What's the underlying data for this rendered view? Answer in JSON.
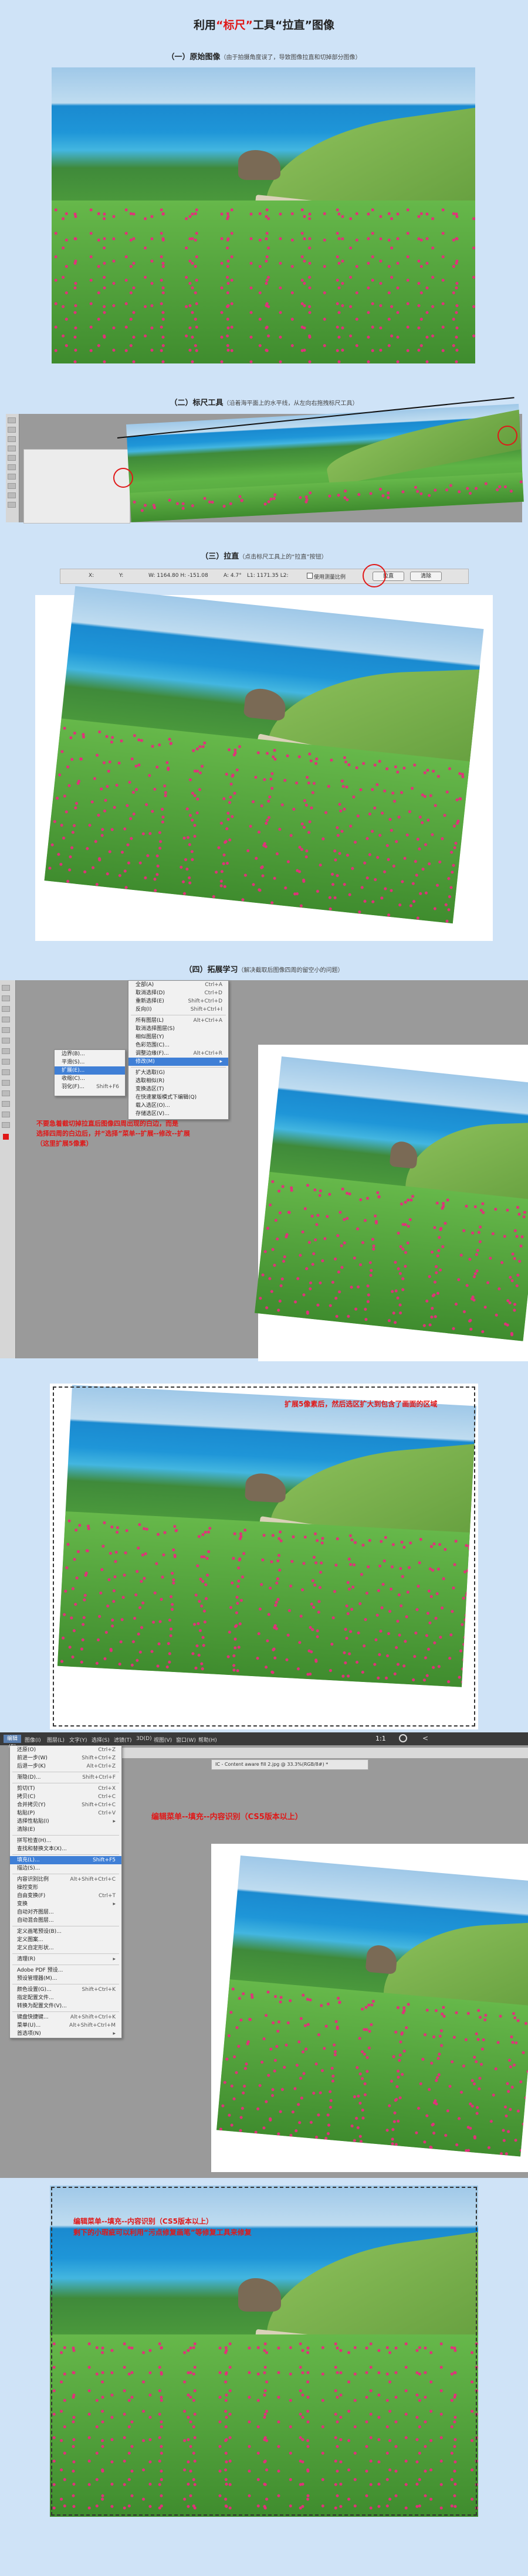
{
  "title": {
    "pre": "利用",
    "highlight": "“标尺”",
    "post": "工具“拉直”图像"
  },
  "sections": [
    {
      "title": "（一）原始图像",
      "note": "（由于拍摄角度误了，导致图像拉直和切掉部分图像）"
    },
    {
      "title": "（二）标尺工具",
      "note": "（沿着海平面上的水平线，从左向右拖拽标尺工具）"
    },
    {
      "title": "（三）拉直",
      "note": "（点击标尺工具上的“拉直”按钮）"
    },
    {
      "title": "（四）拓展学习",
      "note": "（解决截取后图像四周的留空小的问题）"
    }
  ],
  "ruler_options": {
    "x": "X:",
    "y": "Y:",
    "w": "W: 1164.80  H: -151.08",
    "a": "A: 4.7°",
    "l": "L1: 1171.35  L2:",
    "checkbox": "使用测量比例",
    "straighten": "拉直",
    "clear": "清除"
  },
  "select_menu": {
    "items": [
      {
        "label": "全部(A)",
        "shortcut": "Ctrl+A"
      },
      {
        "label": "取消选择(D)",
        "shortcut": "Ctrl+D"
      },
      {
        "label": "重新选择(E)",
        "shortcut": "Shift+Ctrl+D"
      },
      {
        "label": "反向(I)",
        "shortcut": "Shift+Ctrl+I"
      },
      {
        "label": "所有图层(L)",
        "shortcut": "Alt+Ctrl+A"
      },
      {
        "label": "取消选择图层(S)",
        "shortcut": ""
      },
      {
        "label": "相似图层(Y)",
        "shortcut": ""
      },
      {
        "label": "色彩范围(C)...",
        "shortcut": ""
      },
      {
        "label": "调整边缘(F)...",
        "shortcut": "Alt+Ctrl+R"
      },
      {
        "label": "修改(M)",
        "shortcut": "▸"
      },
      {
        "label": "扩大选取(G)",
        "shortcut": ""
      },
      {
        "label": "选取相似(R)",
        "shortcut": ""
      },
      {
        "label": "变换选区(T)",
        "shortcut": ""
      },
      {
        "label": "在快速蒙版模式下编辑(Q)",
        "shortcut": ""
      },
      {
        "label": "载入选区(O)...",
        "shortcut": ""
      },
      {
        "label": "存储选区(V)...",
        "shortcut": ""
      }
    ],
    "submenu": [
      {
        "label": "边界(B)...",
        "shortcut": ""
      },
      {
        "label": "平滑(S)...",
        "shortcut": ""
      },
      {
        "label": "扩展(E)...",
        "shortcut": ""
      },
      {
        "label": "收缩(C)...",
        "shortcut": ""
      },
      {
        "label": "羽化(F)...",
        "shortcut": "Shift+F6"
      }
    ]
  },
  "note_expand": [
    "不要急着截切掉拉直后图像四周出现的白边，而是",
    "选择四周的白边后，并“选择”菜单--扩展--修改--扩展",
    "（这里扩展5像素）"
  ],
  "note_select": "扩展5像素后，然后选区扩大到包含了画面的区域",
  "edit_menu": {
    "bar": [
      "编辑(E)",
      "图像(I)",
      "图层(L)",
      "文字(Y)",
      "选择(S)",
      "滤镜(T)",
      "3D(D)",
      "视图(V)",
      "窗口(W)",
      "帮助(H)"
    ],
    "items": [
      {
        "label": "还原(O)",
        "shortcut": "Ctrl+Z"
      },
      {
        "label": "前进一步(W)",
        "shortcut": "Shift+Ctrl+Z"
      },
      {
        "label": "后退一步(K)",
        "shortcut": "Alt+Ctrl+Z"
      },
      {
        "label": "渐隐(D)...",
        "shortcut": "Shift+Ctrl+F"
      },
      {
        "label": "剪切(T)",
        "shortcut": "Ctrl+X"
      },
      {
        "label": "拷贝(C)",
        "shortcut": "Ctrl+C"
      },
      {
        "label": "合并拷贝(Y)",
        "shortcut": "Shift+Ctrl+C"
      },
      {
        "label": "粘贴(P)",
        "shortcut": "Ctrl+V"
      },
      {
        "label": "选择性粘贴(I)",
        "shortcut": "▸"
      },
      {
        "label": "清除(E)",
        "shortcut": ""
      },
      {
        "label": "拼写检查(H)...",
        "shortcut": ""
      },
      {
        "label": "查找和替换文本(X)...",
        "shortcut": ""
      },
      {
        "label": "填充(L)...",
        "shortcut": "Shift+F5"
      },
      {
        "label": "描边(S)...",
        "shortcut": ""
      },
      {
        "label": "内容识别比例",
        "shortcut": "Alt+Shift+Ctrl+C"
      },
      {
        "label": "操控变形",
        "shortcut": ""
      },
      {
        "label": "自由变换(F)",
        "shortcut": "Ctrl+T"
      },
      {
        "label": "变换",
        "shortcut": "▸"
      },
      {
        "label": "自动对齐图层...",
        "shortcut": ""
      },
      {
        "label": "自动混合图层...",
        "shortcut": ""
      },
      {
        "label": "定义画笔预设(B)...",
        "shortcut": ""
      },
      {
        "label": "定义图案...",
        "shortcut": ""
      },
      {
        "label": "定义自定形状...",
        "shortcut": ""
      },
      {
        "label": "清理(R)",
        "shortcut": "▸"
      },
      {
        "label": "Adobe PDF 预设...",
        "shortcut": ""
      },
      {
        "label": "预设管理器(M)...",
        "shortcut": ""
      },
      {
        "label": "颜色设置(G)...",
        "shortcut": "Shift+Ctrl+K"
      },
      {
        "label": "指定配置文件...",
        "shortcut": ""
      },
      {
        "label": "转换为配置文件(V)...",
        "shortcut": ""
      },
      {
        "label": "键盘快捷键...",
        "shortcut": "Alt+Shift+Ctrl+K"
      },
      {
        "label": "菜单(U)...",
        "shortcut": "Alt+Shift+Ctrl+M"
      },
      {
        "label": "首选项(N)",
        "shortcut": "▸"
      }
    ],
    "doc_tab": "IC - Content aware fill 2.jpg @ 33.3%(RGB/8#) *",
    "zoom_label": "1:1"
  },
  "note_fill": "编辑菜单--填充--内容识别（CS5版本以上）",
  "note_final": [
    "编辑菜单--填充--内容识别（CS5版本以上）",
    "剩下的小瑕疵可以利用“污点修复画笔”等修复工具来修复"
  ],
  "colors": {
    "accent_red": "#e01818",
    "page_bg": "#cfe3f7",
    "highlight_blue": "#3f7fd6"
  }
}
